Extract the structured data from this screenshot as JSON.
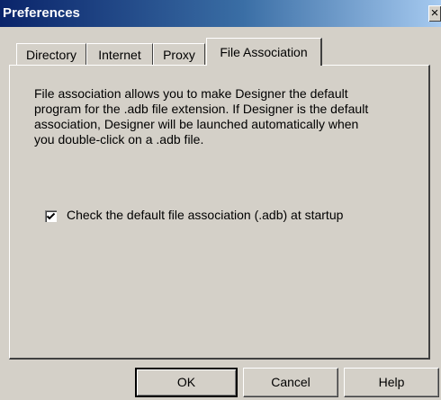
{
  "window": {
    "title": "Preferences",
    "close_glyph": "×"
  },
  "tabs": [
    {
      "label": "Directory",
      "active": false
    },
    {
      "label": "Internet",
      "active": false
    },
    {
      "label": "Proxy",
      "active": false
    },
    {
      "label": "File Association",
      "active": true
    }
  ],
  "panel": {
    "description": "File association allows you to make Designer the default program for the .adb file extension.  If Designer is the default association, Designer will be launched automatically when you double-click on a .adb file.",
    "checkbox": {
      "label": "Check the default file association (.adb) at startup",
      "checked": true
    }
  },
  "buttons": {
    "ok": "OK",
    "cancel": "Cancel",
    "help": "Help"
  }
}
